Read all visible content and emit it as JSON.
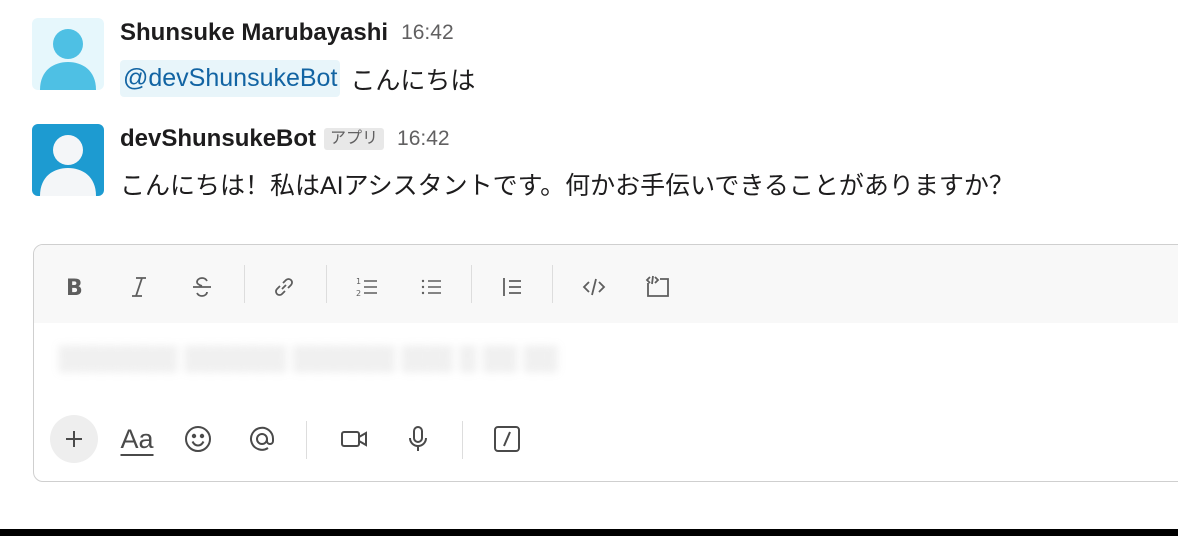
{
  "messages": [
    {
      "sender": "Shunsuke Marubayashi",
      "time": "16:42",
      "mention": "@devShunsukeBot",
      "text": "こんにちは",
      "avatar_color": "#4ec0e4"
    },
    {
      "sender": "devShunsukeBot",
      "badge": "アプリ",
      "time": "16:42",
      "text": "こんにちは！私はAIアシスタントです。何かお手伝いできることがありますか？",
      "avatar_color": "#1d9bd1"
    }
  ],
  "composer": {
    "toolbar": [
      "bold-icon",
      "italic-icon",
      "strikethrough-icon",
      "link-icon",
      "ordered-list-icon",
      "bulleted-list-icon",
      "blockquote-icon",
      "code-icon",
      "code-block-icon"
    ],
    "placeholder": "░░░░░░░ ░░░░░░ ░░░░░░ ░░░ ░ ░░ ░░",
    "bottom_toolbar": [
      "plus-icon",
      "format-text-icon",
      "emoji-icon",
      "mention-icon",
      "video-icon",
      "microphone-icon",
      "shortcut-icon"
    ],
    "format_label": "Aa"
  },
  "colors": {
    "mention_text": "#1264a3",
    "mention_bg": "#e8f5fa"
  }
}
